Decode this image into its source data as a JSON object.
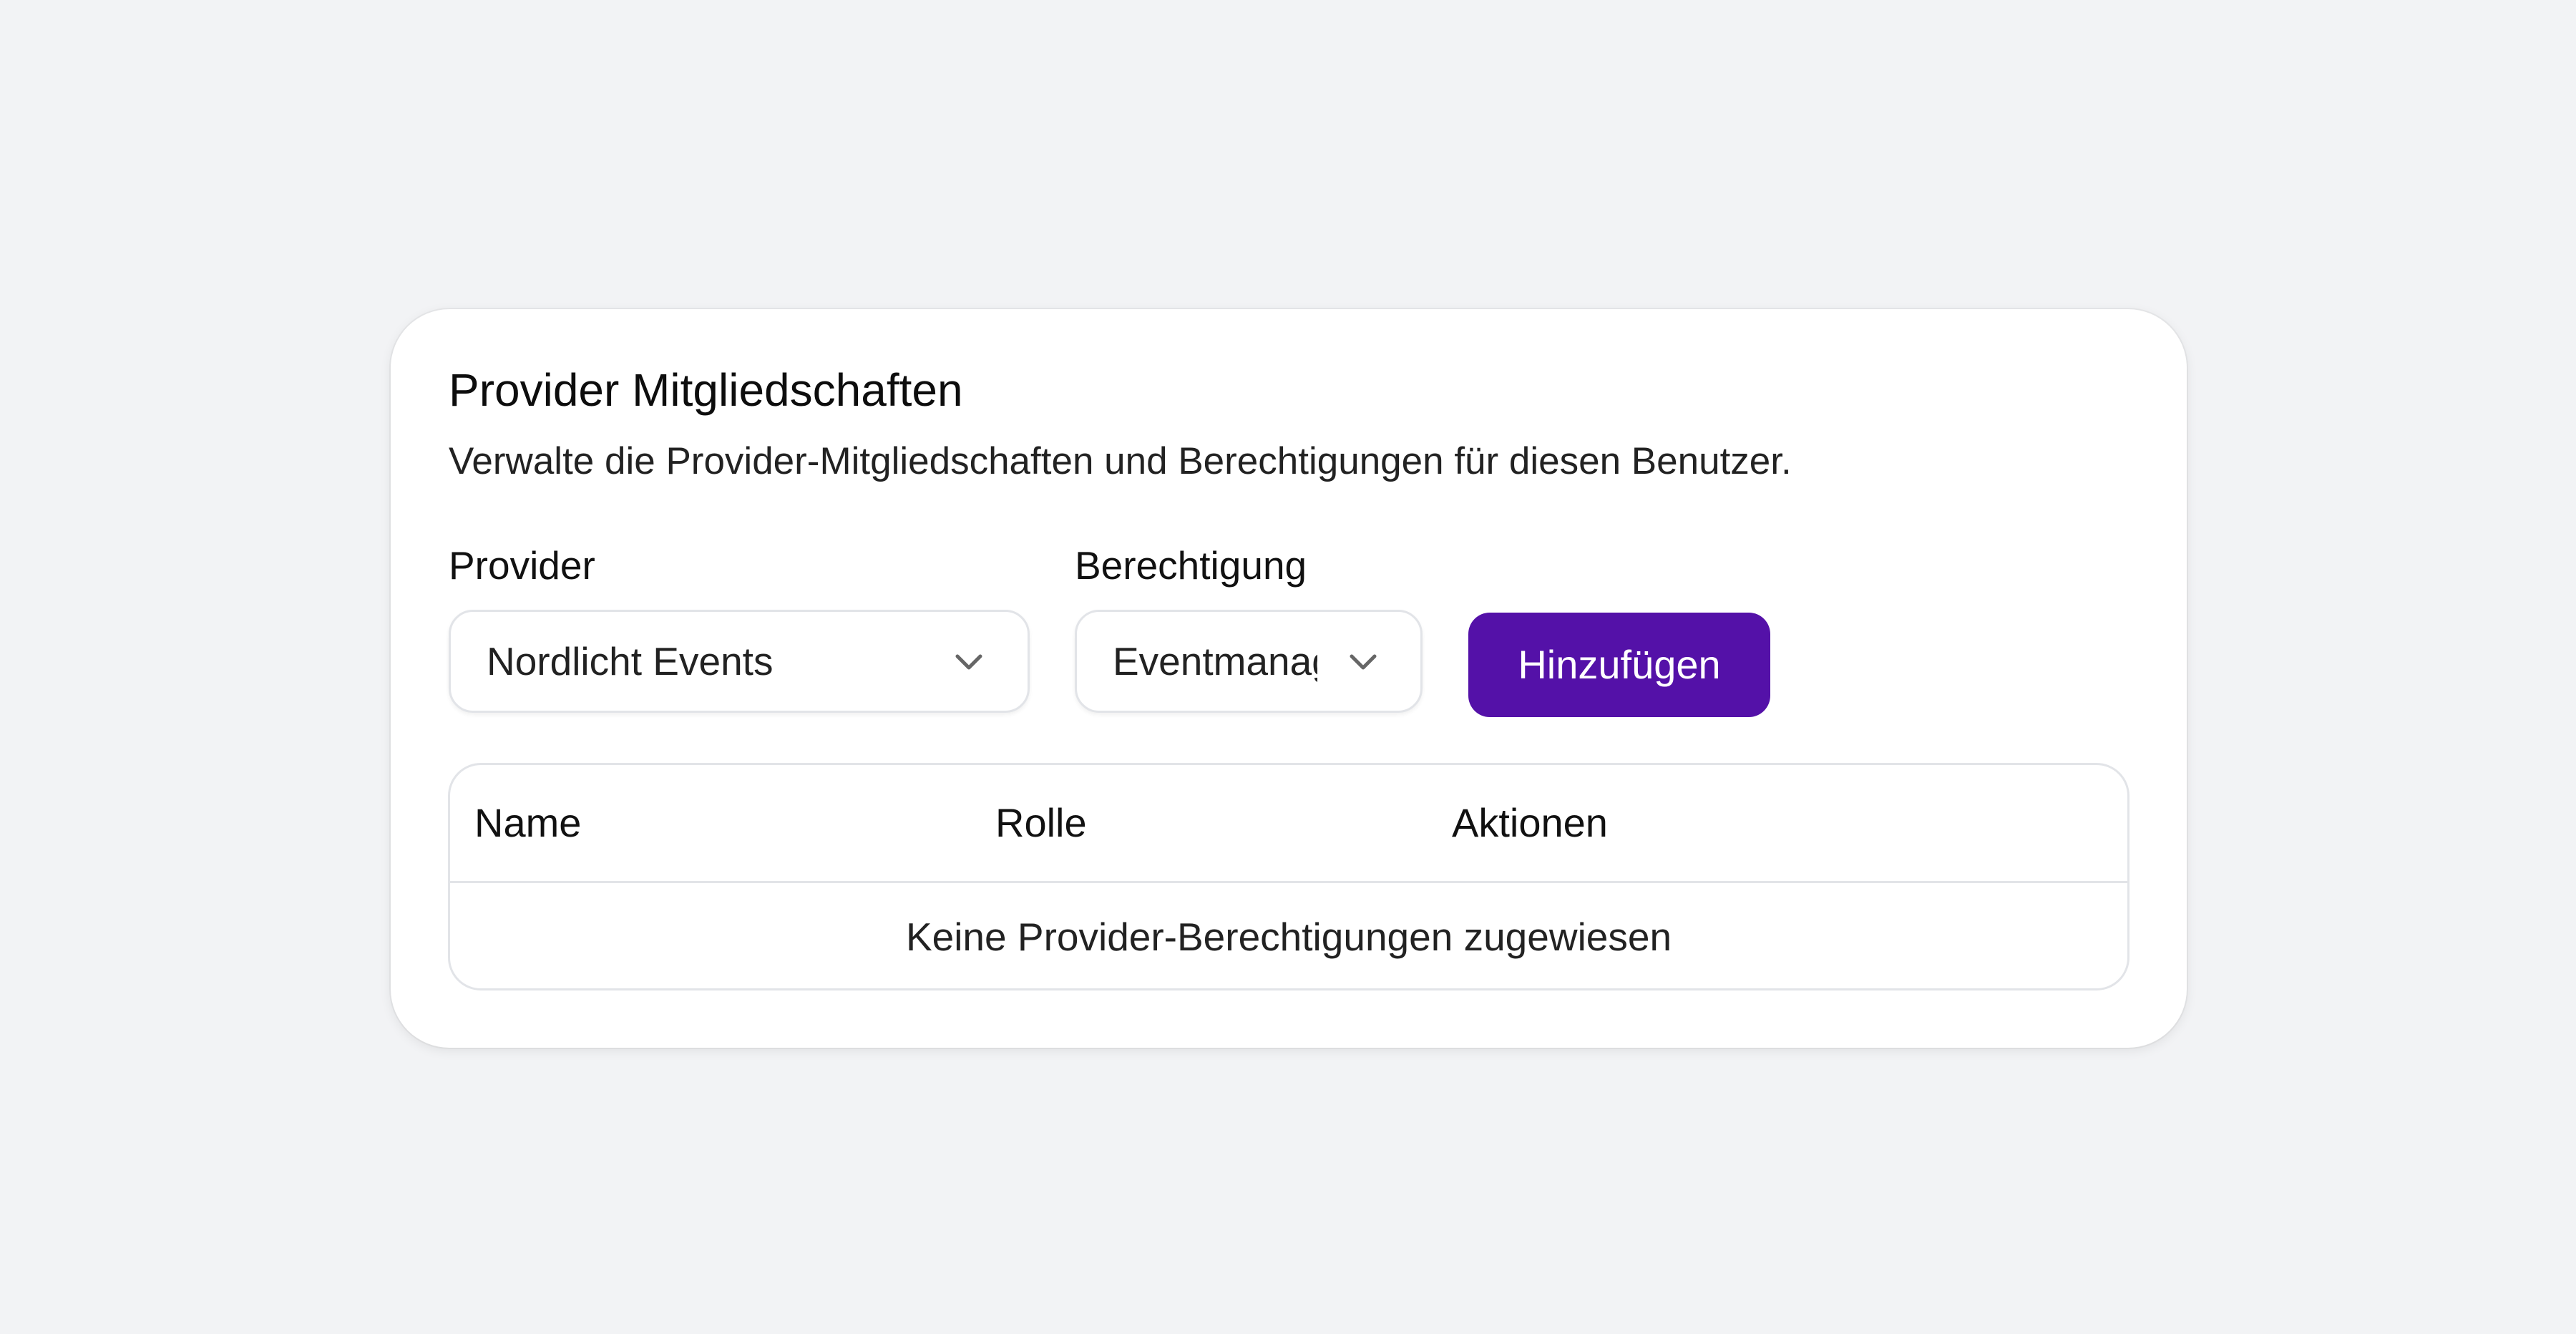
{
  "card": {
    "title": "Provider Mitgliedschaften",
    "subtitle": "Verwalte die Provider-Mitgliedschaften und Berechtigungen für diesen Benutzer."
  },
  "form": {
    "provider_label": "Provider",
    "provider_value": "Nordlicht Events",
    "permission_label": "Berechtigung",
    "permission_value": "Eventmanag",
    "add_button": "Hinzufügen",
    "chevron_icon": "chevron-down-icon"
  },
  "table": {
    "columns": [
      "Name",
      "Rolle",
      "Aktionen"
    ],
    "empty_message": "Keine Provider-Berechtigungen zugewiesen"
  },
  "colors": {
    "page_background": "#f2f3f5",
    "card_background": "#ffffff",
    "accent": "#5411a8",
    "border": "#e2e4e8"
  }
}
